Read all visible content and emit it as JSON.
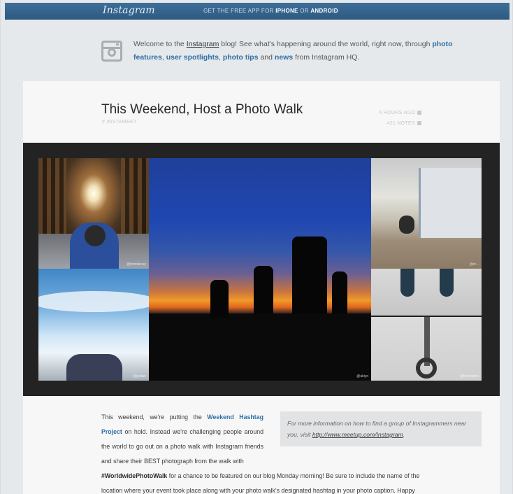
{
  "topbar": {
    "logo": "Instagram",
    "promo_prefix": "GET THE FREE APP FOR ",
    "promo_iphone": "IPHONE",
    "promo_or": " OR ",
    "promo_android": "ANDROID"
  },
  "welcome": {
    "icon": "instagram-camera-icon",
    "t1": "Welcome to the ",
    "t2": "Instagram",
    "t3": " blog! See what's happening around the world, right now, through ",
    "link_features": "photo features",
    "c1": ", ",
    "link_spotlights": "user spotlights",
    "c2": ", ",
    "link_tips": "photo tips",
    "and": " and ",
    "link_news": "news",
    "t4": " from Instagram HQ."
  },
  "post": {
    "title": "This Weekend, Host a Photo Walk",
    "tag": "# INSTAMEET",
    "time": "6 HOURS AGO",
    "notes": "421 NOTES",
    "photo_credits": [
      "@mintdecay",
      "@jordan",
      "@ukiyo",
      "@cr...",
      "@tomrobins"
    ],
    "body": {
      "p1_a": "This weekend, we're putting the ",
      "p1_link": "Weekend Hashtag Project",
      "p1_b": " on hold. Instead we're challenging people around the world to go out on a photo walk with Instagram friends and share their BEST photograph from the walk with",
      "p2_tag": "#WorldwidePhotoWalk",
      "p2_rest": " for a chance to be featured on our blog Monday morning! Be sure to include the name of the location where your event took place along with your photo walk's designated hashtag in your photo caption. Happy adventuring, Instagrammers!"
    },
    "callout": {
      "text": "For more information on how to find a group of Instagrammers near you, visit ",
      "link": "http://www.meetup.com/Instagram",
      "end": "."
    }
  },
  "colors": {
    "topbar": "#30608c",
    "link": "#2f6fa5",
    "background": "#e6e9eb",
    "card": "#f7f7f7",
    "frame": "#232323"
  }
}
